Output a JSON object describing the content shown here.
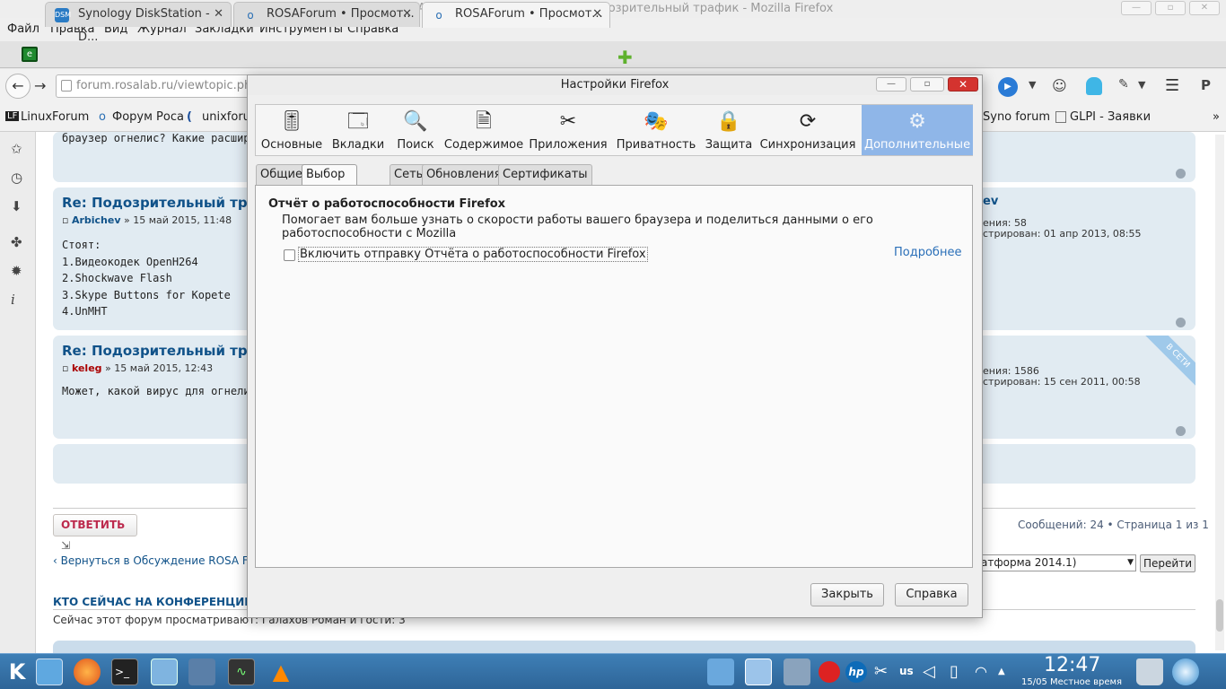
{
  "window": {
    "title": "ROSAForum • Просмотр темы - Подозрительный трафик - Mozilla Firefox"
  },
  "menu": [
    "Файл",
    "Правка",
    "Вид",
    "Журнал",
    "Закладки",
    "Инструменты",
    "Справка"
  ],
  "tabs": [
    {
      "label": "Synology DiskStation - D...",
      "favicon": "DSM"
    },
    {
      "label": "ROSAForum • Просмот...",
      "favicon": "rosa"
    },
    {
      "label": "ROSAForum • Просмот...",
      "favicon": "rosa",
      "active": true
    }
  ],
  "url": "forum.rosalab.ru/viewtopic.php?",
  "bookmarks": [
    "LinuxForum",
    "Форум Роса",
    "unixforu",
    "Syno forum",
    "GLPI - Заявки"
  ],
  "posts": [
    {
      "snippet": "браузер огнелис? Какие расширен"
    },
    {
      "title": "Re: Подозрительный трафи",
      "author": "Arbichev",
      "date": "» 15 май 2015, 11:48",
      "body": [
        "Стоят:",
        "1.Видеокодек OpenH264",
        "2.Shockwave Flash",
        "3.Skype Buttons for Kopete",
        "4.UnMHT"
      ],
      "profile_author": "ev",
      "profile_messages_label": "ения:",
      "profile_messages": "58",
      "profile_reg_label": "стрирован:",
      "profile_reg": "01 апр 2013, 08:55"
    },
    {
      "title": "Re: Подозрительный трафи",
      "author": "keleg",
      "date": "» 15 май 2015, 12:43",
      "body": [
        "Может, какой вирус для огнелиса"
      ],
      "profile_messages_label": "ения:",
      "profile_messages": "1586",
      "profile_reg_label": "стрирован:",
      "profile_reg": "15 сен 2011, 00:58",
      "badge": "В СЕТИ"
    }
  ],
  "reply_button": "ОТВЕТИТЬ",
  "pagination": "Сообщений: 24 • Страница 1 из 1",
  "back_link": "Вернуться в Обсуждение ROSA Fre",
  "jump_select": "атформа 2014.1)",
  "jump_button": "Перейти",
  "online_heading": "КТО СЕЙЧАС НА КОНФЕРЕНЦИИ",
  "online_text": "Сейчас этот форум просматривают: Галахов Роман и гости: 3",
  "dialog": {
    "title": "Настройки Firefox",
    "toolbar": [
      {
        "label": "Основные",
        "icon": "sliders-icon"
      },
      {
        "label": "Вкладки",
        "icon": "tabs-icon"
      },
      {
        "label": "Поиск",
        "icon": "magnifier-icon"
      },
      {
        "label": "Содержимое",
        "icon": "content-icon"
      },
      {
        "label": "Приложения",
        "icon": "apps-icon"
      },
      {
        "label": "Приватность",
        "icon": "mask-icon"
      },
      {
        "label": "Защита",
        "icon": "lock-icon"
      },
      {
        "label": "Синхронизация",
        "icon": "sync-icon"
      },
      {
        "label": "Дополнительные",
        "icon": "gear-icon",
        "selected": true
      }
    ],
    "subtabs": [
      "Общие",
      "Выбор данных",
      "Сеть",
      "Обновления",
      "Сертификаты"
    ],
    "section_title": "Отчёт о работоспособности Firefox",
    "section_desc": "Помогает вам больше узнать о скорости работы вашего браузера и поделиться данными о его работоспособности с Mozilla",
    "checkbox_label": "Включить отправку Отчёта о работоспособности Firefox",
    "learn_more": "Подробнее",
    "close_button": "Закрыть",
    "help_button": "Справка"
  },
  "taskbar": {
    "lang": "us",
    "time": "12:47",
    "date": "15/05 Местное время"
  },
  "colors": {
    "accent": "#8fb6e8",
    "forum_link": "#105289",
    "reply_red": "#bc2a4d",
    "taskbar": "#3a78ae"
  }
}
